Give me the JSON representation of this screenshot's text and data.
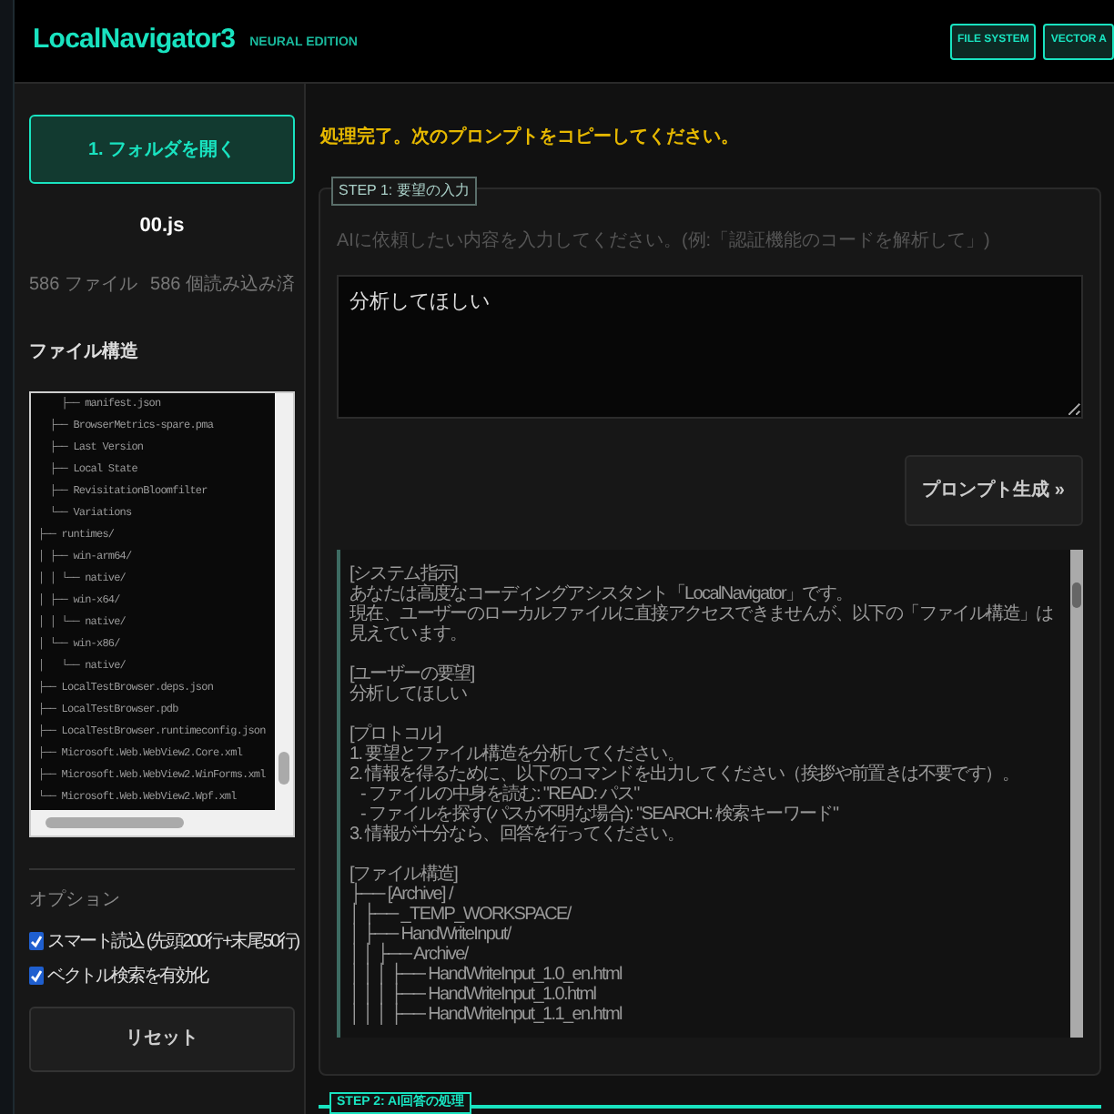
{
  "header": {
    "title": "LocalNavigator3",
    "edition": "NEURAL EDITION",
    "nav_buttons": [
      "FILE SYSTEM",
      "VECTOR A"
    ]
  },
  "sidebar": {
    "open_button": "1. フォルダを開く",
    "current_file": "00.js",
    "file_count": "586 ファイル",
    "loaded_count": "586 個読み込み済",
    "tree_label": "ファイル構造",
    "tree_lines": [
      "    ├── manifest.json",
      "  ├── BrowserMetrics-spare.pma",
      "  ├── Last Version",
      "  ├── Local State",
      "  ├── RevisitationBloomfilter",
      "  └── Variations",
      "├── runtimes/",
      "│ ├── win-arm64/",
      "│ │ └── native/",
      "│ ├── win-x64/",
      "│ │ └── native/",
      "│ └── win-x86/",
      "│   └── native/",
      "├── LocalTestBrowser.deps.json",
      "├── LocalTestBrowser.pdb",
      "├── LocalTestBrowser.runtimeconfig.json",
      "├── Microsoft.Web.WebView2.Core.xml",
      "├── Microsoft.Web.WebView2.WinForms.xml",
      "└── Microsoft.Web.WebView2.Wpf.xml"
    ],
    "options_label": "オプション",
    "options": [
      {
        "label": "スマート読込 (先頭200行+末尾50行)",
        "checked": true
      },
      {
        "label": "ベクトル検索を有効化",
        "checked": true
      }
    ],
    "reset_button": "リセット"
  },
  "main": {
    "status": "処理完了。次のプロンプトをコピーしてください。",
    "step1": {
      "legend": "STEP 1: 要望の入力",
      "hint": "AIに依頼したい内容を入力してください。(例:「認証機能のコードを解析して」)",
      "request": "分析してほしい",
      "generate_button": "プロンプト生成 »",
      "prompt_sections": [
        [
          "[システム指示]",
          "あなたは高度なコーディングアシスタント「LocalNavigator」です。",
          "現在、ユーザーのローカルファイルに直接アクセスできませんが、以下の「ファイル構造」は見えています。"
        ],
        [
          "[ユーザーの要望]",
          "分析してほしい"
        ],
        [
          "[プロトコル]",
          "1. 要望とファイル構造を分析してください。",
          "2. 情報を得るために、以下のコマンドを出力してください（挨拶や前置きは不要です）。",
          "   - ファイルの中身を読む: \"READ: パス\"",
          "   - ファイルを探す(パスが不明な場合): \"SEARCH: 検索キーワード\"",
          "3. 情報が十分なら、回答を行ってください。"
        ],
        [
          "[ファイル構造]",
          "├── [Archive] /",
          "│ ├── _TEMP_WORKSPACE/",
          "│ ├── HandWriteInput/",
          "│ │ ├── Archive/",
          "│ │ │ ├── HandWriteInput_1.0_en.html",
          "│ │ │ ├── HandWriteInput_1.0.html",
          "│ │ │ ├── HandWriteInput_1.1_en.html"
        ]
      ]
    },
    "step2": {
      "legend": "STEP 2: AI回答の処理"
    }
  }
}
